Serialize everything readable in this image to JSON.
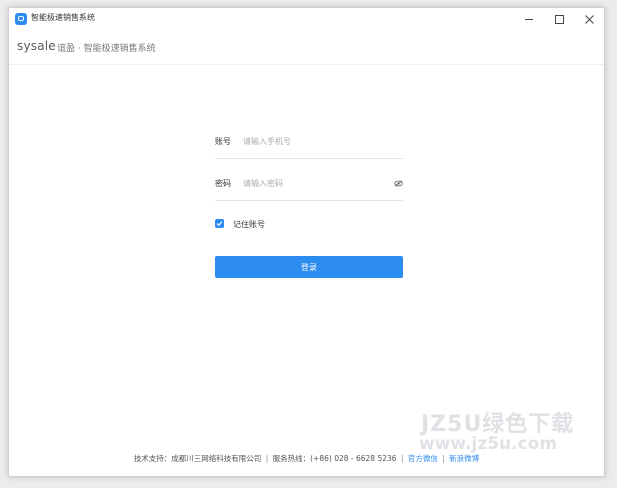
{
  "window": {
    "title": "智能极速销售系统"
  },
  "header": {
    "logo": "sysale",
    "subtitle": "谊盈 · 智能极速销售系统"
  },
  "form": {
    "account_label": "账号",
    "account_placeholder": "请输入手机号",
    "account_value": "",
    "password_label": "密码",
    "password_placeholder": "请输入密码",
    "password_value": "",
    "remember_label": "记住账号",
    "remember_checked": true,
    "login_label": "登录"
  },
  "footer": {
    "support": "技术支持：成都川三网络科技有限公司",
    "hotline": "服务热线：(+86) 028 - 6628 5236",
    "wechat": "官方微信",
    "weibo": "新浪微博",
    "separator": "|"
  },
  "watermark": {
    "line1": "JZ5U绿色下载",
    "line2": "www.jz5u.com"
  },
  "colors": {
    "accent": "#2d8cf0",
    "border": "#e2e2e2",
    "text": "#333333",
    "placeholder": "#a9a9a9"
  },
  "icons": {
    "app": "app-chat-icon",
    "eye": "eye-icon",
    "check": "checkmark-icon"
  }
}
